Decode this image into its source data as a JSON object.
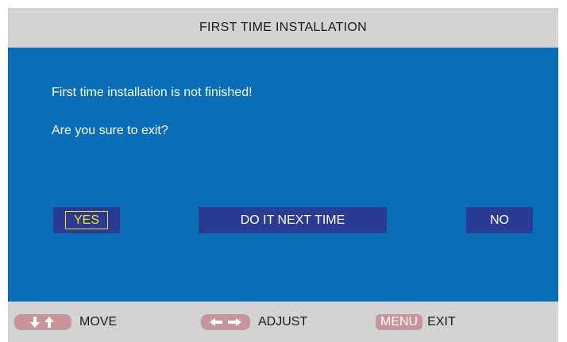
{
  "title": "FIRST TIME INSTALLATION",
  "dialog": {
    "message_line1": "First time installation is not finished!",
    "message_line2": "Are you sure to exit?"
  },
  "buttons": {
    "yes": "YES",
    "next_time": "DO IT NEXT TIME",
    "no": "NO",
    "selected": "yes"
  },
  "footer": {
    "move": {
      "icon": "up-down-arrows-icon",
      "label": "MOVE"
    },
    "adjust": {
      "icon": "left-right-arrows-icon",
      "label": "ADJUST"
    },
    "exit": {
      "key": "MENU",
      "label": "EXIT"
    }
  },
  "colors": {
    "title_bar": "#d3d3d3",
    "dialog_bg": "#0a6db8",
    "button_bg": "#2b3a93",
    "selected_text": "#f5e01e",
    "key_bg": "#c9949a"
  }
}
